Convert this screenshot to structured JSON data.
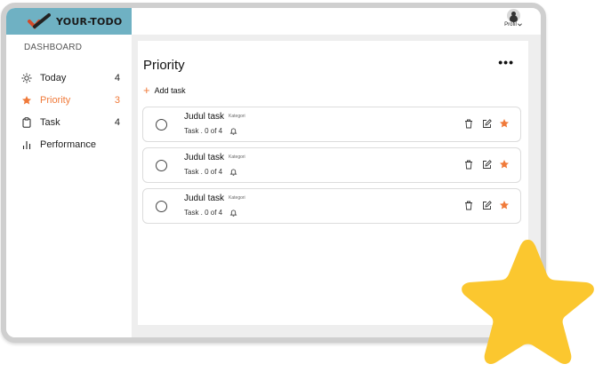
{
  "app": {
    "logo_text": "YOUR-TODO"
  },
  "sidebar": {
    "section_label": "DASHBOARD",
    "items": [
      {
        "label": "Today",
        "count": "4",
        "icon": "sun-icon"
      },
      {
        "label": "Priority",
        "count": "3",
        "icon": "star-icon",
        "active": true
      },
      {
        "label": "Task",
        "count": "4",
        "icon": "clipboard-icon"
      },
      {
        "label": "Performance",
        "count": "",
        "icon": "bar-chart-icon"
      }
    ]
  },
  "header": {
    "profile_label": "Profil"
  },
  "main": {
    "title": "Priority",
    "more_label": "•••",
    "add_task_label": "Add task",
    "tasks": [
      {
        "title": "Judul task",
        "category": "Kategori",
        "sub": "Task . 0 of 4"
      },
      {
        "title": "Judul task",
        "category": "Kategori",
        "sub": "Task . 0 of 4"
      },
      {
        "title": "Judul task",
        "category": "Kategori",
        "sub": "Task . 0 of 4"
      }
    ]
  },
  "colors": {
    "accent": "#f07a3a",
    "logo_bar": "#6fb1c3",
    "big_star": "#fbc72f",
    "main_bg": "#eeeeee"
  }
}
